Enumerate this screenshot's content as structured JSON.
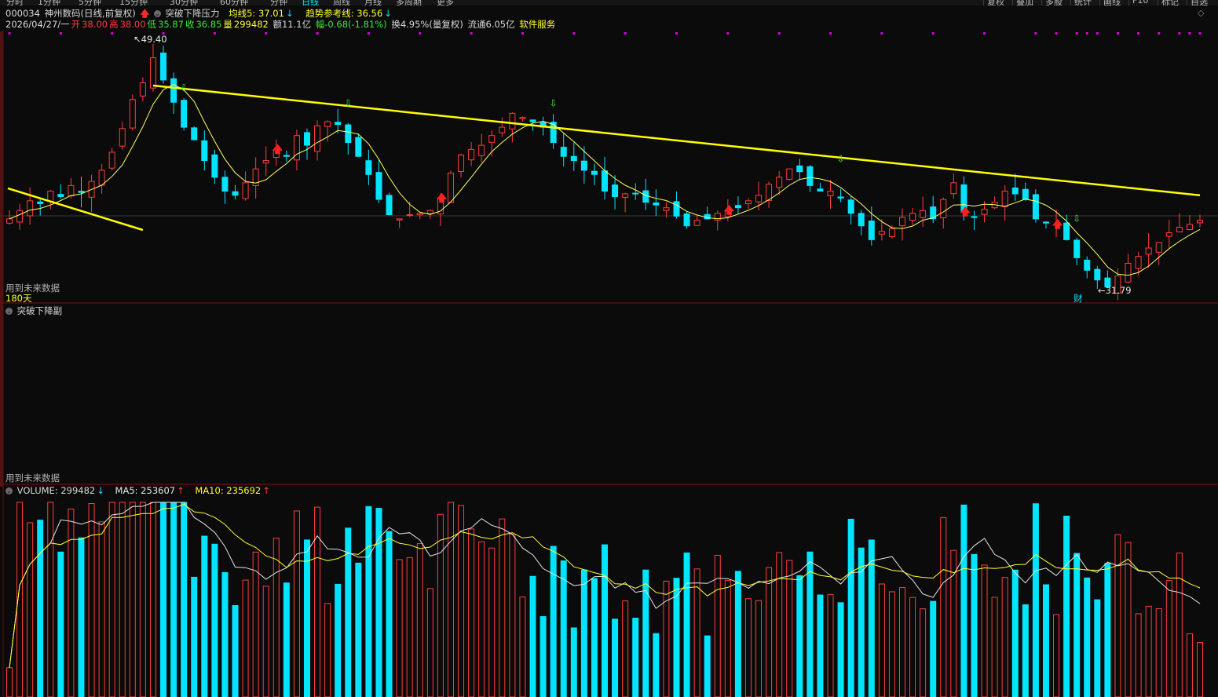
{
  "topbar": {
    "left_tabs": [
      "分时",
      "1分钟",
      "5分钟",
      "15分钟",
      "30分钟",
      "60分钟",
      "分钟",
      "日线",
      "周线",
      "月线",
      "多周期",
      "更多"
    ],
    "right_buttons": [
      "复权",
      "叠加",
      "多股",
      "统计",
      "画线",
      "F10",
      "标记",
      "自选"
    ]
  },
  "header": {
    "code": "000034",
    "name": "神州数码(日线,前复权)",
    "indicator": "突破下降压力",
    "ma5_label": "均线5: 37.01",
    "ma5_arrow": "↓",
    "trend_label": "趋势参考线: 36.56",
    "trend_arrow": "↓"
  },
  "quote": {
    "date": "2026/04/27/一",
    "open_label": "开",
    "open": "38.00",
    "high_label": "高",
    "high": "38.00",
    "low_label": "低",
    "low": "35.87",
    "close_label": "收",
    "close": "36.85",
    "vol_label": "量",
    "vol": "299482",
    "amount": "额11.1亿",
    "change": "幅-0.68(-1.81%)",
    "turnover": "换4.95%(量复权)",
    "float": "流通6.05亿",
    "sector": "软件服务"
  },
  "main_panel": {
    "high_marker": "49.40",
    "low_marker": "31.79",
    "fin_badge": "财",
    "future_note": "用到未来数据",
    "days_label": "180天"
  },
  "sub_panel": {
    "title": "突破下降副",
    "future_note": "用到未来数据"
  },
  "volume_panel": {
    "title": "VOLUME: 299482",
    "title_arrow": "↓",
    "ma5": "MA5: 253607",
    "ma5_arrow": "↑",
    "ma10": "MA10: 235692",
    "ma10_arrow": "↑"
  },
  "colors": {
    "up": "#ff3c3c",
    "down": "#00e4ff",
    "trend_line": "#ffff00",
    "ma_line": "#ffff66",
    "accent_magenta": "#d400d4"
  },
  "chart_data": {
    "type": "candlestick",
    "price_range": [
      31.0,
      50.5
    ],
    "high": 49.4,
    "low": 31.79,
    "last": {
      "open": 38.0,
      "high": 38.0,
      "low": 35.87,
      "close": 36.85,
      "volume": 299482
    },
    "close_series": [
      37.0,
      37.6,
      38.3,
      38.1,
      39.0,
      38.6,
      39.4,
      38.9,
      39.7,
      40.5,
      41.8,
      43.5,
      45.6,
      46.8,
      48.6,
      47.0,
      45.4,
      43.6,
      42.7,
      41.2,
      40.0,
      39.0,
      38.7,
      39.6,
      40.6,
      41.2,
      42.0,
      41.5,
      43.0,
      42.3,
      43.7,
      44.0,
      43.8,
      42.5,
      41.5,
      40.2,
      38.4,
      37.3,
      37.0,
      37.3,
      37.4,
      37.6,
      38.5,
      40.3,
      41.6,
      42.0,
      42.3,
      43.0,
      43.6,
      44.6,
      44.3,
      44.0,
      43.6,
      42.5,
      41.5,
      41.2,
      40.5,
      40.2,
      39.0,
      38.6,
      38.8,
      38.8,
      38.2,
      38.0,
      37.8,
      37.2,
      36.5,
      36.9,
      37.0,
      37.4,
      37.6,
      37.8,
      38.3,
      38.7,
      39.5,
      40.0,
      40.6,
      40.4,
      39.4,
      39.0,
      39.0,
      38.5,
      37.4,
      36.5,
      35.5,
      36.1,
      36.3,
      37.1,
      37.4,
      37.6,
      37.0,
      38.4,
      39.6,
      37.5,
      37.1,
      37.7,
      38.2,
      39.0,
      38.8,
      38.4,
      37.0,
      36.7,
      36.6,
      35.5,
      34.2,
      33.3,
      32.6,
      32.1,
      32.9,
      33.8,
      34.3,
      34.9,
      35.3,
      36.0,
      36.4,
      36.6,
      36.9
    ],
    "volume_ma5_series": [],
    "series": [
      {
        "name": "均线5",
        "value": 37.01
      },
      {
        "name": "趋势参考线",
        "value": 36.56
      },
      {
        "name": "MA5",
        "value": 253607
      },
      {
        "name": "MA10",
        "value": 235692
      }
    ]
  }
}
